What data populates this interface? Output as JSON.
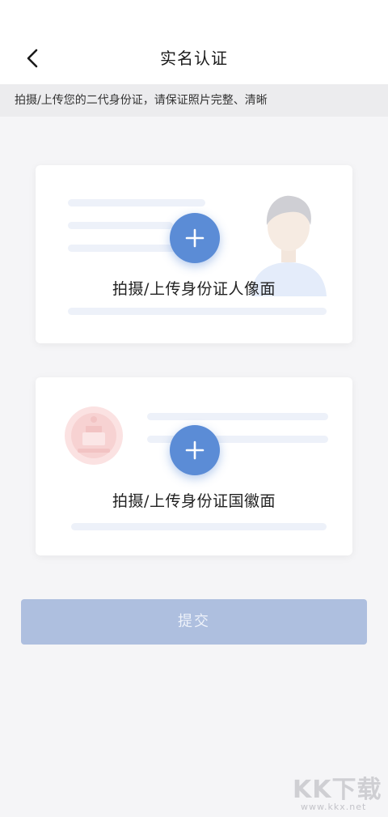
{
  "header": {
    "title": "实名认证",
    "back_icon": "chevron-left-icon"
  },
  "notice": {
    "text": "拍摄/上传您的二代身份证，请保证照片完整、清晰"
  },
  "id_front": {
    "label": "拍摄/上传身份证人像面",
    "icon": "plus-icon"
  },
  "id_back": {
    "label": "拍摄/上传身份证国徽面",
    "icon": "plus-icon"
  },
  "submit": {
    "label": "提交"
  },
  "watermark": {
    "logo": "KK下载",
    "url": "www.kkx.net"
  },
  "colors": {
    "accent": "#5b8cd6",
    "submit_disabled": "#aebfdf",
    "background": "#f5f5f7"
  }
}
